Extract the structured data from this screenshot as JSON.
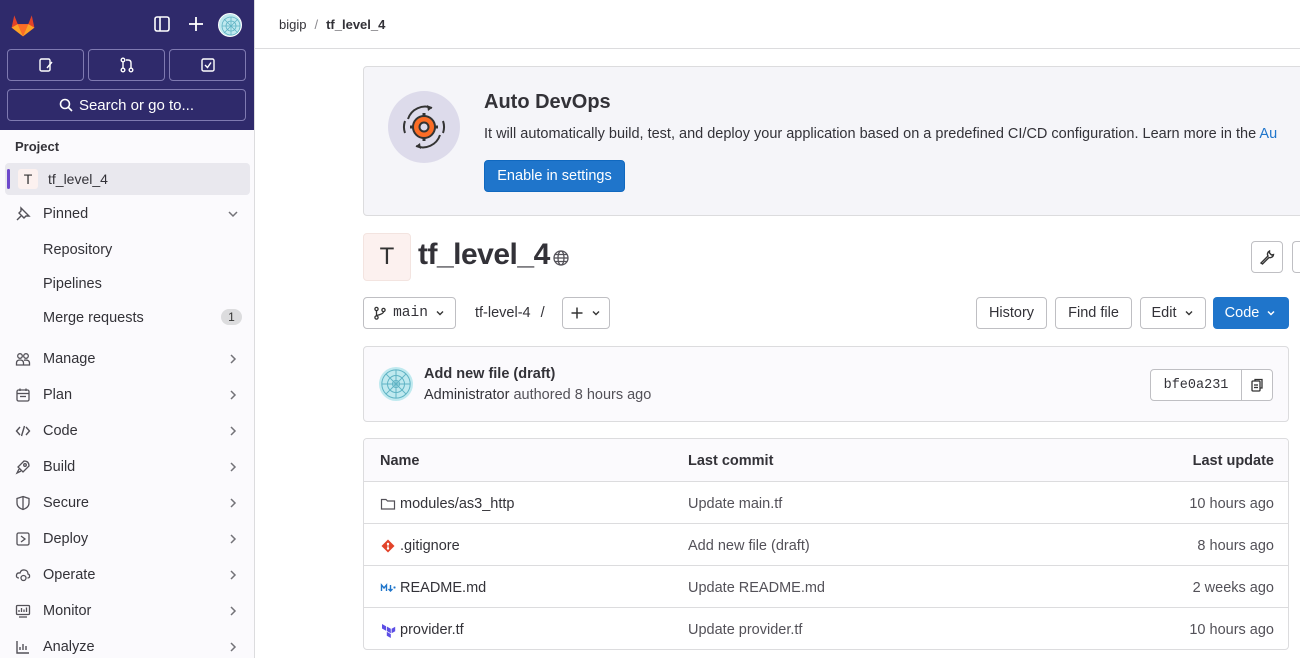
{
  "sidebar": {
    "search_label": "Search or go to...",
    "section_title": "Project",
    "project": {
      "initial": "T",
      "name": "tf_level_4"
    },
    "pinned": {
      "label": "Pinned",
      "items": [
        {
          "label": "Repository"
        },
        {
          "label": "Pipelines"
        },
        {
          "label": "Merge requests",
          "badge": "1"
        }
      ]
    },
    "nav": [
      {
        "label": "Manage",
        "icon": "users-icon"
      },
      {
        "label": "Plan",
        "icon": "calendar-icon"
      },
      {
        "label": "Code",
        "icon": "code-icon"
      },
      {
        "label": "Build",
        "icon": "rocket-icon"
      },
      {
        "label": "Secure",
        "icon": "shield-icon"
      },
      {
        "label": "Deploy",
        "icon": "deploy-icon"
      },
      {
        "label": "Operate",
        "icon": "cloud-gear-icon"
      },
      {
        "label": "Monitor",
        "icon": "monitor-icon"
      },
      {
        "label": "Analyze",
        "icon": "chart-icon"
      }
    ]
  },
  "breadcrumb": {
    "group": "bigip",
    "project": "tf_level_4",
    "separator": "/"
  },
  "banner": {
    "title": "Auto DevOps",
    "text": "It will automatically build, test, and deploy your application based on a predefined CI/CD configuration. Learn more in the ",
    "link": "Au",
    "button": "Enable in settings"
  },
  "project_header": {
    "initial": "T",
    "title": "tf_level_4"
  },
  "toolbar": {
    "branch": "main",
    "path": "tf-level-4",
    "path_sep": "/",
    "history": "History",
    "find_file": "Find file",
    "edit": "Edit",
    "code": "Code"
  },
  "commit": {
    "title": "Add new file (draft)",
    "author": "Administrator",
    "meta": " authored 8 hours ago",
    "sha": "bfe0a231"
  },
  "files": {
    "headers": {
      "name": "Name",
      "last_commit": "Last commit",
      "last_update": "Last update"
    },
    "rows": [
      {
        "name": "modules/as3_http",
        "icon": "folder-icon",
        "commit": "Update main.tf",
        "updated": "10 hours ago"
      },
      {
        "name": ".gitignore",
        "icon": "git-icon",
        "commit": "Add new file (draft)",
        "updated": "8 hours ago"
      },
      {
        "name": "README.md",
        "icon": "markdown-icon",
        "commit": "Update README.md",
        "updated": "2 weeks ago"
      },
      {
        "name": "provider.tf",
        "icon": "terraform-icon",
        "commit": "Update provider.tf",
        "updated": "10 hours ago"
      }
    ]
  },
  "colors": {
    "sidebar_top": "#2f2a6b",
    "primary": "#1f75cb",
    "active_bar": "#6e49cb"
  }
}
